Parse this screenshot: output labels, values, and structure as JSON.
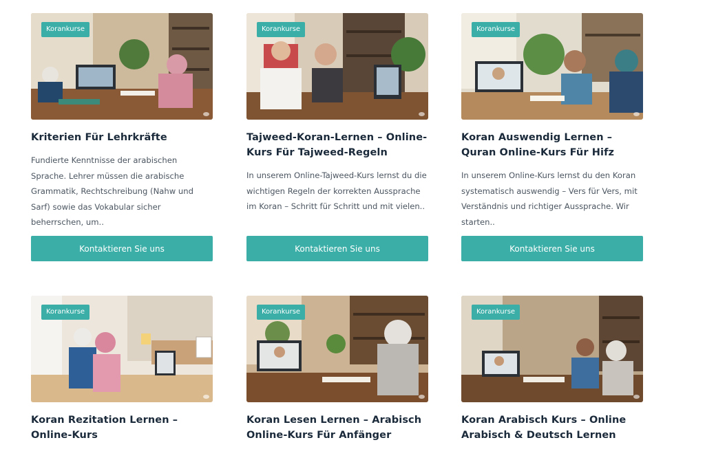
{
  "cards": [
    {
      "badge": "Korankurse",
      "title": "Kriterien Für Lehrkräfte",
      "description": "Fundierte Kenntnisse der arabischen Sprache. Lehrer müssen die arabische Grammatik, Rechtschreibung (Nahw und Sarf) sowie das Vokabular sicher beherrschen, um..",
      "button": "Kontaktieren Sie uns"
    },
    {
      "badge": "Korankurse",
      "title": "Tajweed-Koran-Lernen – Online-Kurs Für Tajweed-Regeln",
      "description": "In unserem Online-Tajweed-Kurs lernst du die wichtigen Regeln der korrekten Aussprache im Koran – Schritt für Schritt und mit vielen..",
      "button": "Kontaktieren Sie uns"
    },
    {
      "badge": "Korankurse",
      "title": "Koran Auswendig Lernen – Quran Online-Kurs Für Hifz",
      "description": "In unserem Online-Kurs lernst du den Koran systematisch auswendig – Vers für Vers, mit Verständnis und richtiger Aussprache. Wir starten..",
      "button": "Kontaktieren Sie uns"
    },
    {
      "badge": "Korankurse",
      "title": "Koran Rezitation Lernen – Online-Kurs"
    },
    {
      "badge": "Korankurse",
      "title": "Koran Lesen Lernen – Arabisch Online-Kurs Für Anfänger"
    },
    {
      "badge": "Korankurse",
      "title": "Koran Arabisch Kurs – Online Arabisch & Deutsch Lernen"
    }
  ],
  "colors": {
    "accent": "#3aaea7",
    "title": "#1b2a3a",
    "text": "#4b5560"
  },
  "icons": {
    "thumbnail": "online-quran-lesson-photo",
    "corner": "video-indicator-icon"
  }
}
